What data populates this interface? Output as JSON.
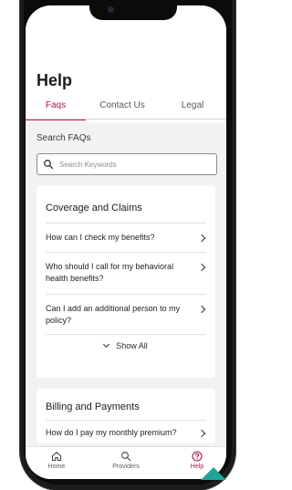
{
  "page": {
    "title": "Help"
  },
  "tabs": [
    {
      "label": "Faqs"
    },
    {
      "label": "Contact Us"
    },
    {
      "label": "Legal"
    }
  ],
  "search": {
    "label": "Search FAQs",
    "placeholder": "Search Keywords",
    "value": ""
  },
  "sections": [
    {
      "title": "Coverage and Claims",
      "items": [
        {
          "question": "How can I check my benefits?"
        },
        {
          "question": "Who should I call for my behavioral health benefits?"
        },
        {
          "question": "Can I add an additional person to my policy?"
        }
      ],
      "show_all": "Show All"
    },
    {
      "title": "Billing and Payments",
      "items": [
        {
          "question": "How do I pay my monthly premium?"
        }
      ]
    }
  ],
  "bottom_nav": [
    {
      "label": "Home",
      "icon": "home-icon"
    },
    {
      "label": "Providers",
      "icon": "search-icon"
    },
    {
      "label": "Help",
      "icon": "help-circle-icon"
    }
  ],
  "colors": {
    "accent": "#c2185b",
    "background": "#f2f2f4",
    "teal": "#20a49a"
  }
}
